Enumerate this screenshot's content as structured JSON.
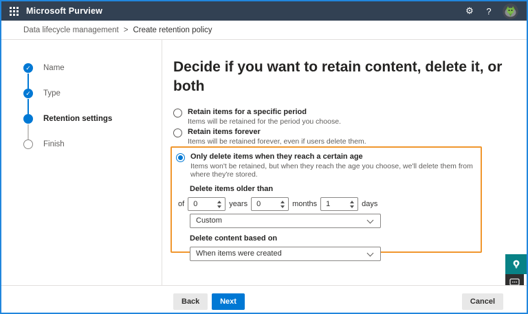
{
  "topbar": {
    "title": "Microsoft Purview",
    "icons": {
      "app_launcher": "waffle-grid",
      "settings": "gear",
      "help": "question-mark",
      "account": "avatar"
    }
  },
  "breadcrumb": {
    "section": "Data lifecycle management",
    "separator": ">",
    "page": "Create retention policy"
  },
  "steps": [
    {
      "label": "Name",
      "state": "complete"
    },
    {
      "label": "Type",
      "state": "complete"
    },
    {
      "label": "Retention settings",
      "state": "current"
    },
    {
      "label": "Finish",
      "state": "upcoming"
    }
  ],
  "main": {
    "title": "Decide if you want to retain content, delete it, or both",
    "options": [
      {
        "label": "Retain items for a specific period",
        "description": "Items will be retained for the period you choose.",
        "selected": false
      },
      {
        "label": "Retain items forever",
        "description": "Items will be retained forever, even if users delete them.",
        "selected": false
      },
      {
        "label": "Only delete items when they reach a certain age",
        "description": "Items won't be retained, but when they reach the age you choose, we'll delete them from where they're stored.",
        "selected": true
      }
    ],
    "age_settings": {
      "heading": "Delete items older than",
      "prefix": "of",
      "years_value": "0",
      "years_label": "years",
      "months_value": "0",
      "months_label": "months",
      "days_value": "1",
      "days_label": "days",
      "duration_dropdown_value": "Custom"
    },
    "basis": {
      "heading": "Delete content based on",
      "dropdown_value": "When items were created"
    }
  },
  "footer": {
    "back": "Back",
    "next": "Next",
    "cancel": "Cancel"
  },
  "colors": {
    "accent": "#0078d4",
    "highlight_border": "#f0962d",
    "topbar_bg": "#324153",
    "teal_widget": "#088286",
    "window_border": "#2186dd"
  }
}
